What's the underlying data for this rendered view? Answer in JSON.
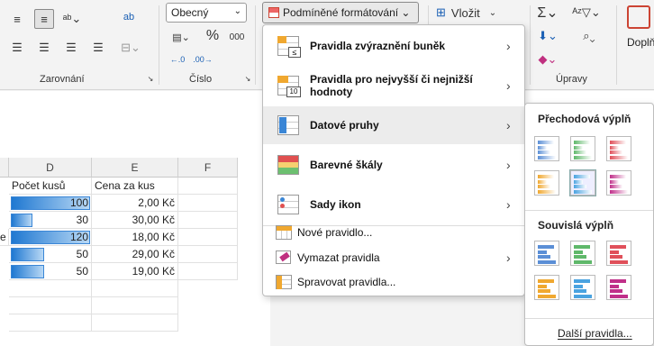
{
  "ribbon": {
    "groups": {
      "alignment": "Zarovnání",
      "number": "Číslo",
      "editing": "Úpravy",
      "addins_partial": "Doplň"
    },
    "number_format": "Obecný",
    "percent": "%",
    "thousands": "000",
    "cf_button": "Podmíněné formátování",
    "insert": "Vložit",
    "wrap_icon_text": "ab"
  },
  "sheet": {
    "columns": [
      "D",
      "E",
      "F"
    ],
    "header_row": {
      "d": "Počet kusů",
      "e": "Cena za  kus"
    },
    "rows": [
      {
        "qty": "100",
        "qty_value": 100,
        "price": "2,00 Kč"
      },
      {
        "qty": "30",
        "qty_value": 30,
        "price": "30,00 Kč"
      },
      {
        "qty": "120",
        "qty_value": 120,
        "price": "18,00 Kč"
      },
      {
        "qty": "50",
        "qty_value": 50,
        "price": "29,00 Kč"
      },
      {
        "qty": "50",
        "qty_value": 50,
        "price": "19,00 Kč"
      }
    ],
    "clipped_c_text": "e"
  },
  "menu": {
    "items": [
      {
        "label": "Pravidla zvýraznění buněk",
        "has_submenu": true
      },
      {
        "label": "Pravidla pro nejvyšší či nejnižší hodnoty",
        "has_submenu": true
      },
      {
        "label": "Datové pruhy",
        "has_submenu": true
      },
      {
        "label": "Barevné škály",
        "has_submenu": true
      },
      {
        "label": "Sady ikon",
        "has_submenu": true
      },
      {
        "label": "Nové pravidlo...",
        "has_submenu": false
      },
      {
        "label": "Vymazat pravidla",
        "has_submenu": true
      },
      {
        "label": "Spravovat pravidla...",
        "has_submenu": false
      }
    ],
    "icon_number": "10"
  },
  "submenu": {
    "gradient_title": "Přechodová výplň",
    "solid_title": "Souvislá výplň",
    "more": "Další pravidla...",
    "bar_colors": [
      "#5b8fd6",
      "#5fb86a",
      "#e0505a",
      "#f0a830",
      "#4aa3e0",
      "#c0308a"
    ]
  }
}
